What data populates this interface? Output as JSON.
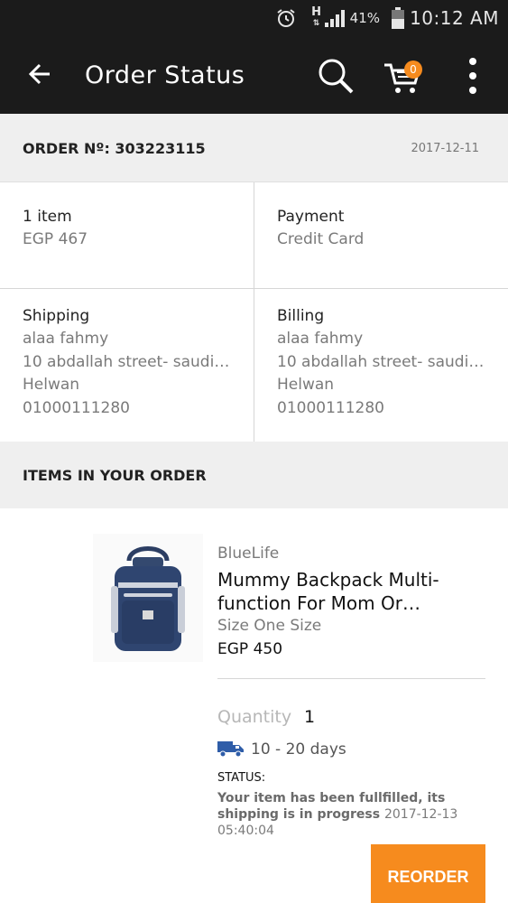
{
  "status_bar": {
    "network": "H",
    "battery_percent": "41%",
    "time": "10:12 AM"
  },
  "app_bar": {
    "title": "Order Status",
    "cart_count": "0",
    "icons": [
      "back-arrow-icon",
      "search-icon",
      "cart-icon",
      "more-vert-icon"
    ]
  },
  "order": {
    "number_label": "ORDER Nº: 303223115",
    "date": "2017-12-11"
  },
  "summary": {
    "items": {
      "title": "1 item",
      "amount": "EGP 467"
    },
    "payment": {
      "title": "Payment",
      "method": "Credit Card"
    },
    "shipping": {
      "title": "Shipping",
      "name": "alaa fahmy",
      "address": "10 abdallah street- saudi…",
      "city": "Helwan",
      "phone": "01000111280"
    },
    "billing": {
      "title": "Billing",
      "name": "alaa fahmy",
      "address": "10 abdallah street- saudi…",
      "city": "Helwan",
      "phone": "01000111280"
    }
  },
  "items_section": {
    "header": "ITEMS IN YOUR ORDER"
  },
  "product": {
    "brand": "BlueLife",
    "name": "Mummy Backpack Multi-function For Mom Or…",
    "size": "Size One Size",
    "price": "EGP 450",
    "quantity_label": "Quantity",
    "quantity": "1",
    "delivery": "10 - 20 days",
    "status_label": "STATUS:",
    "status_text": "Your item has been fullfilled, its shipping is in progress",
    "status_date": "2017-12-13 05:40:04",
    "reorder_label": "REORDER"
  },
  "colors": {
    "app_bar": "#1b1b1b",
    "accent": "#f68b1e",
    "section_bg": "#efefef"
  }
}
